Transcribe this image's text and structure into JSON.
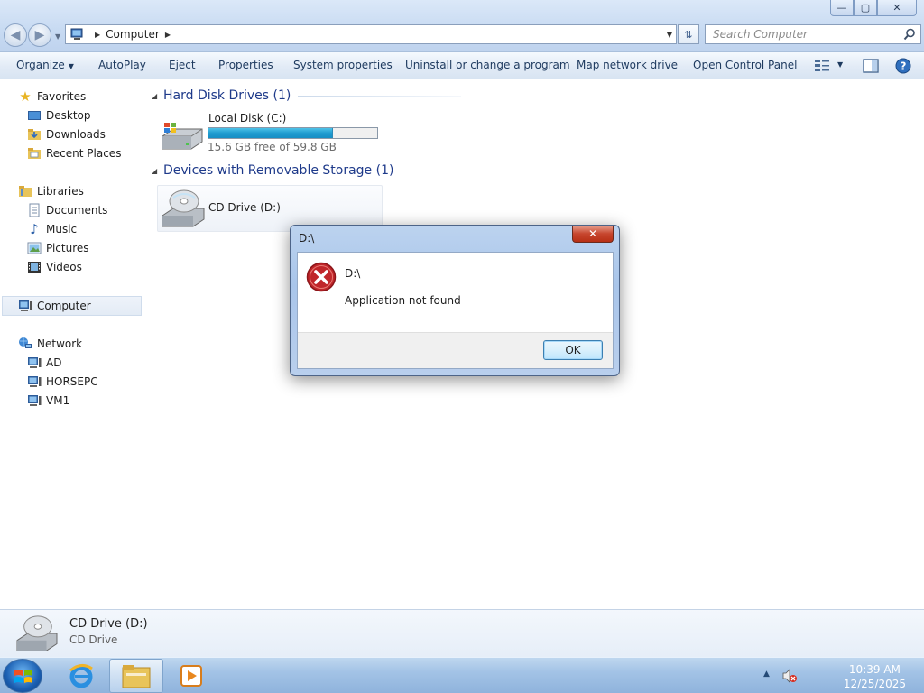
{
  "window": {
    "minimize": "—",
    "maximize": "▢",
    "close": "✕"
  },
  "address": {
    "crumb": "Computer",
    "search_placeholder": "Search Computer"
  },
  "toolbar": {
    "organize": "Organize",
    "autoplay": "AutoPlay",
    "eject": "Eject",
    "properties": "Properties",
    "system_properties": "System properties",
    "uninstall": "Uninstall or change a program",
    "map_drive": "Map network drive",
    "control_panel": "Open Control Panel",
    "help": "?"
  },
  "nav": {
    "favorites": "Favorites",
    "desktop": "Desktop",
    "downloads": "Downloads",
    "recent": "Recent Places",
    "libraries": "Libraries",
    "documents": "Documents",
    "music": "Music",
    "pictures": "Pictures",
    "videos": "Videos",
    "computer": "Computer",
    "network": "Network",
    "net_items": [
      "AD",
      "HORSEPC",
      "VM1"
    ]
  },
  "content": {
    "hdd_header": "Hard Disk Drives (1)",
    "local_disk": "Local Disk (C:)",
    "local_free": "15.6 GB free of 59.8 GB",
    "used_fraction": 0.739,
    "removable_header": "Devices with Removable Storage (1)",
    "cd_drive": "CD Drive (D:)"
  },
  "details": {
    "name": "CD Drive (D:)",
    "type": "CD Drive"
  },
  "dialog": {
    "title": "D:\\",
    "close": "✕",
    "heading": "D:\\",
    "message": "Application not found",
    "ok": "OK"
  },
  "taskbar": {
    "time": "10:39 AM",
    "date": "12/25/2025"
  }
}
